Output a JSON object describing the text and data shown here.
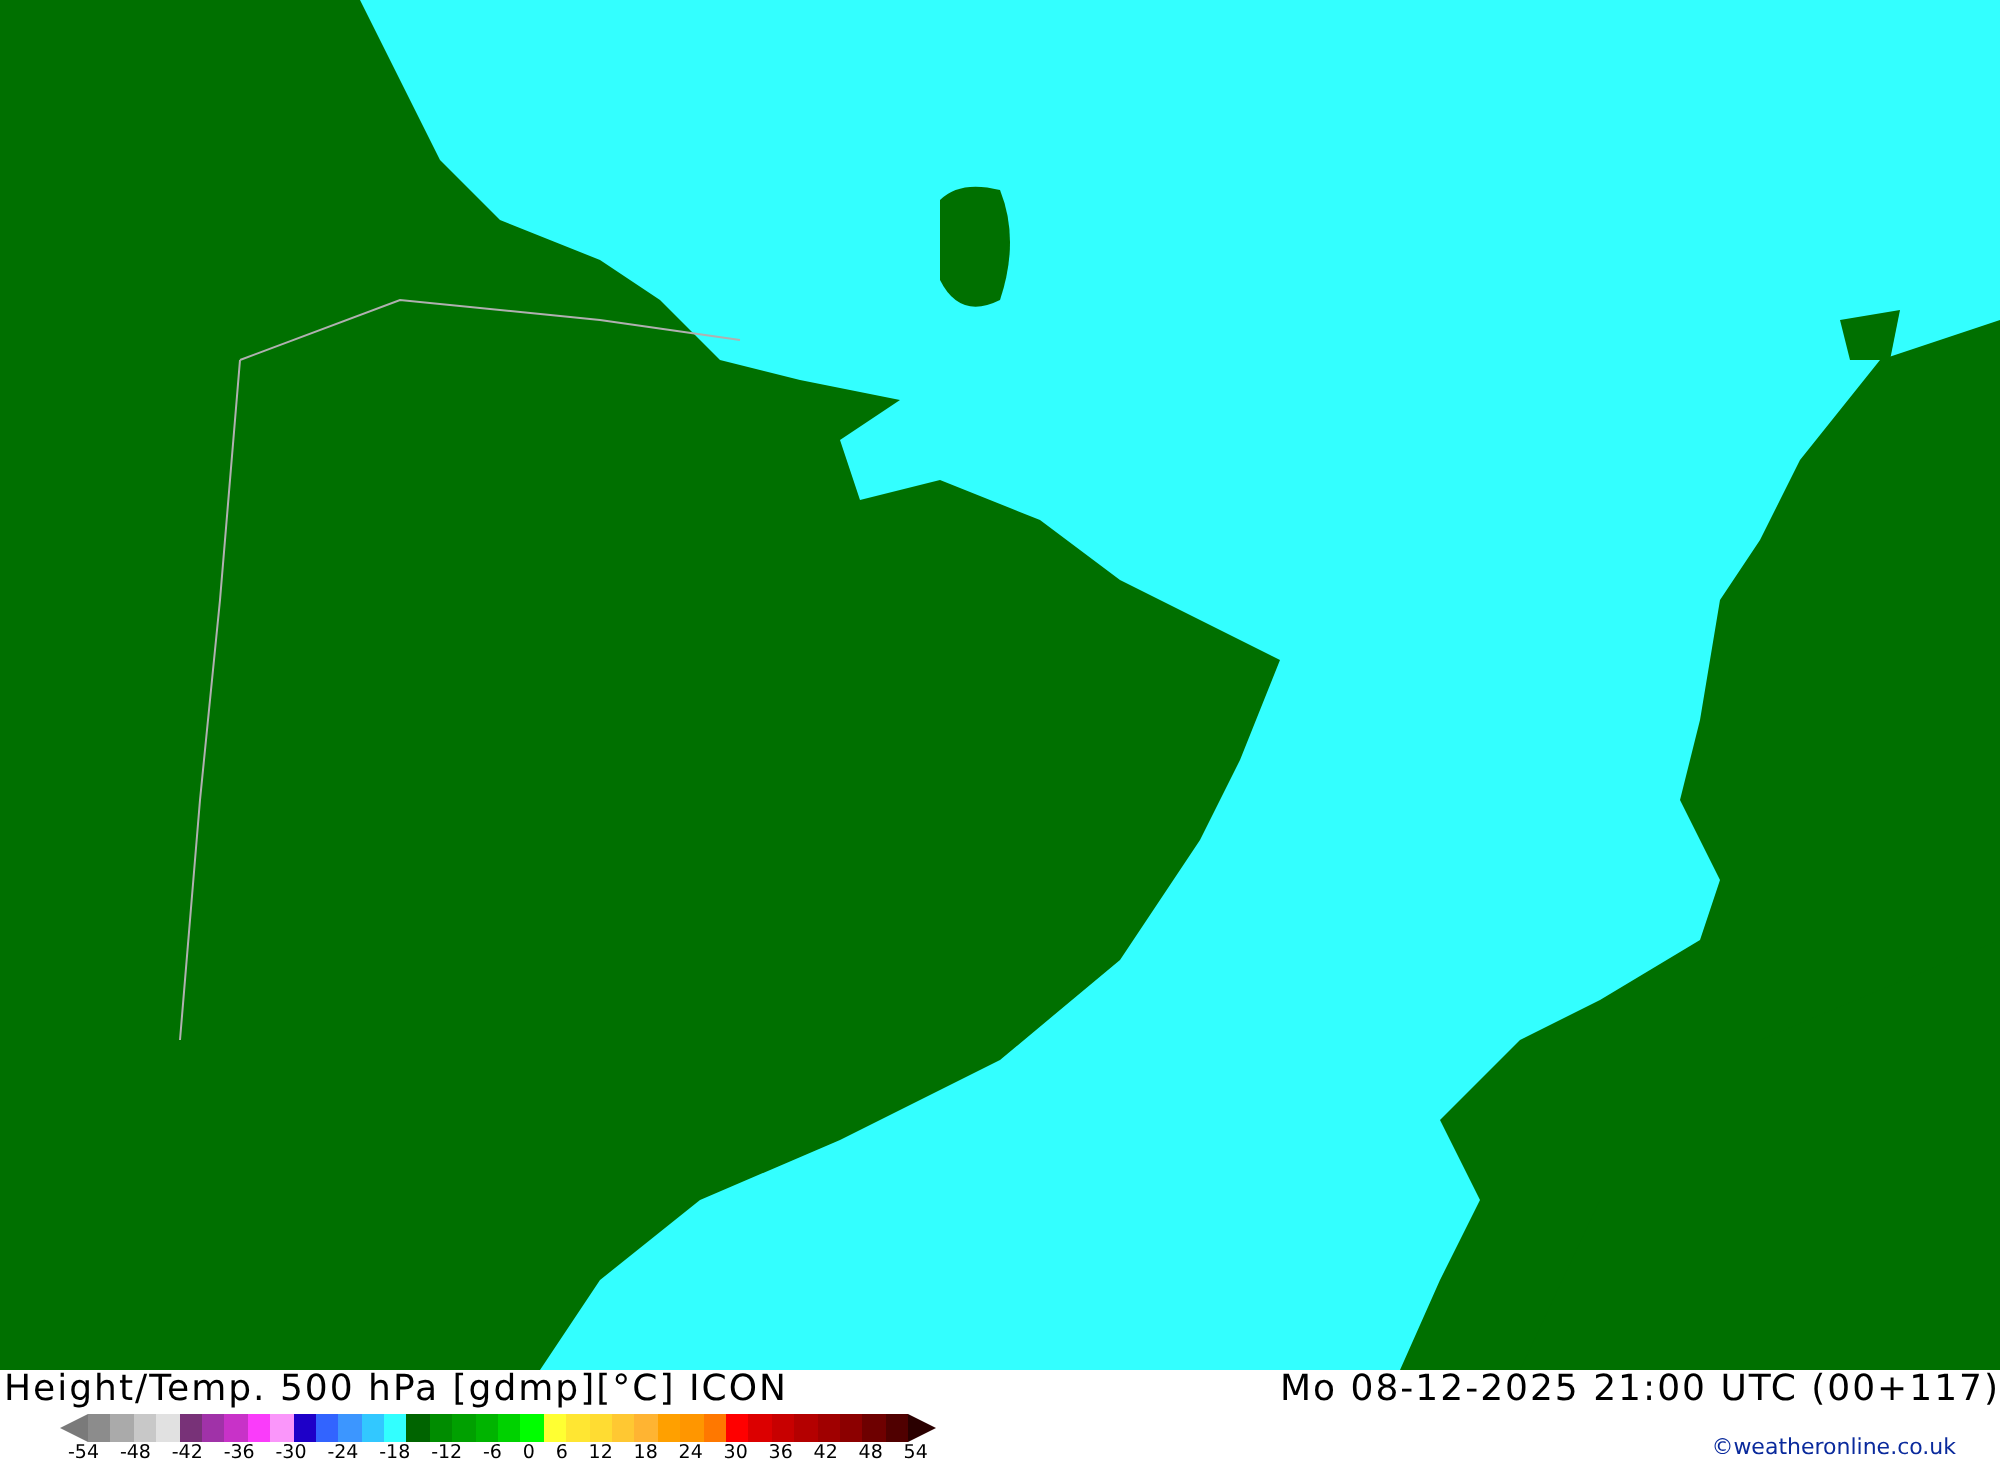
{
  "map": {
    "kind": "weather-map"
  },
  "footer": {
    "title": "Height/Temp. 500 hPa [gdmp][°C] ICON",
    "datetime": "Mo 08-12-2025 21:00 UTC (00+117)",
    "credit": "©weatheronline.co.uk"
  },
  "legend": {
    "arrows": [
      {
        "color": "#7a7a7a"
      },
      {
        "color": "#2a0000"
      }
    ],
    "swatches": [
      {
        "color": "#8c8c8c"
      },
      {
        "color": "#aaaaaa"
      },
      {
        "color": "#c8c8c8"
      },
      {
        "color": "#e1e1e1"
      },
      {
        "color": "#783278"
      },
      {
        "color": "#a032a8"
      },
      {
        "color": "#c832c8"
      },
      {
        "color": "#fa3cfa"
      },
      {
        "color": "#fa96fa"
      },
      {
        "color": "#1e00c8"
      },
      {
        "color": "#3264ff"
      },
      {
        "color": "#3c96ff"
      },
      {
        "color": "#32c8ff"
      },
      {
        "color": "#32ffff"
      },
      {
        "color": "#006400"
      },
      {
        "color": "#008c00"
      },
      {
        "color": "#00a000"
      },
      {
        "color": "#00b400"
      },
      {
        "color": "#00d200"
      },
      {
        "color": "#00ff00"
      },
      {
        "color": "#ffff32"
      },
      {
        "color": "#ffe632"
      },
      {
        "color": "#ffdc32"
      },
      {
        "color": "#ffc832"
      },
      {
        "color": "#ffb432"
      },
      {
        "color": "#ffa000"
      },
      {
        "color": "#ff9600"
      },
      {
        "color": "#ff7800"
      },
      {
        "color": "#ff0000"
      },
      {
        "color": "#dc0000"
      },
      {
        "color": "#c80000"
      },
      {
        "color": "#b40000"
      },
      {
        "color": "#a00000"
      },
      {
        "color": "#8c0000"
      },
      {
        "color": "#6e0000"
      },
      {
        "color": "#500000"
      }
    ],
    "ticks": [
      "-54",
      "-48",
      "-42",
      "-36",
      "-30",
      "-24",
      "-18",
      "-12",
      "-6",
      "0",
      "6",
      "12",
      "18",
      "24",
      "30",
      "36",
      "42",
      "48",
      "54"
    ]
  }
}
